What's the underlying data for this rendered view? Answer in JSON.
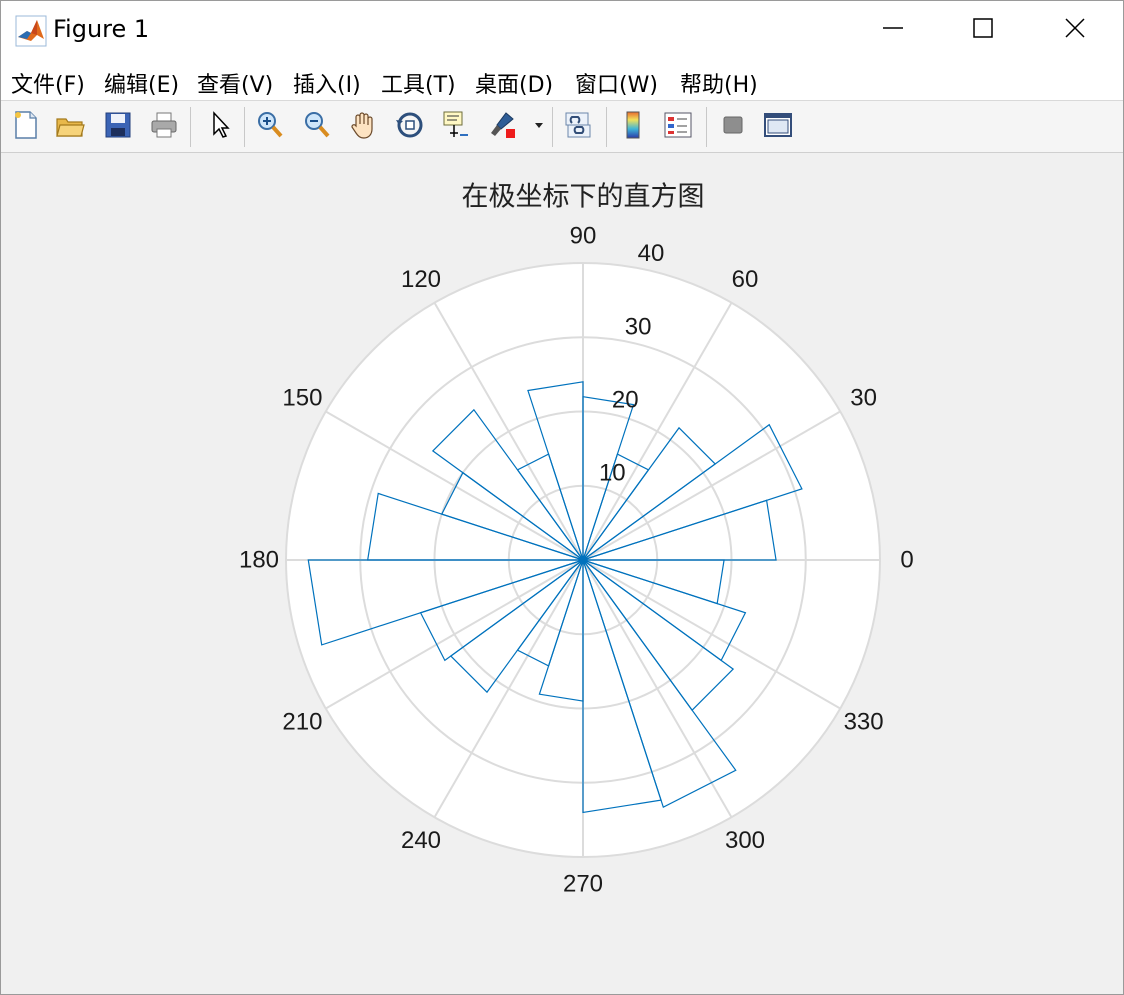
{
  "window": {
    "title": "Figure 1",
    "app_icon": "matlab-icon",
    "controls": [
      "minimize-icon",
      "maximize-icon",
      "close-icon"
    ]
  },
  "menubar": {
    "items": [
      {
        "label": "文件(F)",
        "name": "menu-file"
      },
      {
        "label": "编辑(E)",
        "name": "menu-edit"
      },
      {
        "label": "查看(V)",
        "name": "menu-view"
      },
      {
        "label": "插入(I)",
        "name": "menu-insert"
      },
      {
        "label": "工具(T)",
        "name": "menu-tools"
      },
      {
        "label": "桌面(D)",
        "name": "menu-desktop"
      },
      {
        "label": "窗口(W)",
        "name": "menu-window"
      },
      {
        "label": "帮助(H)",
        "name": "menu-help"
      }
    ]
  },
  "toolbar": {
    "buttons": [
      "new-figure-icon",
      "open-file-icon",
      "save-icon",
      "print-icon",
      "select-arrow-icon",
      "zoom-in-icon",
      "zoom-out-icon",
      "pan-hand-icon",
      "rotate-3d-icon",
      "data-cursor-icon",
      "brush-icon",
      "brush-dropdown-icon",
      "link-plot-icon",
      "colorbar-icon",
      "legend-icon",
      "hide-plot-tools-icon",
      "show-plot-tools-icon"
    ]
  },
  "colors": {
    "series": "#0072bd",
    "grid": "#dcdcdc",
    "axes_bg": "#ffffff",
    "figure_bg": "#f0f0f0"
  },
  "chart_data": {
    "type": "polar-histogram",
    "title": "在极坐标下的直方图",
    "theta_unit": "degrees",
    "theta_ticks": [
      0,
      30,
      60,
      90,
      120,
      150,
      180,
      210,
      240,
      270,
      300,
      330
    ],
    "r_ticks": [
      10,
      20,
      30,
      40
    ],
    "r_lim": [
      0,
      40
    ],
    "bin_width_deg": 18,
    "bins": [
      {
        "start": 0,
        "end": 18,
        "value": 26
      },
      {
        "start": 18,
        "end": 36,
        "value": 31
      },
      {
        "start": 36,
        "end": 54,
        "value": 22
      },
      {
        "start": 54,
        "end": 72,
        "value": 15
      },
      {
        "start": 72,
        "end": 90,
        "value": 22
      },
      {
        "start": 90,
        "end": 108,
        "value": 24
      },
      {
        "start": 108,
        "end": 126,
        "value": 15
      },
      {
        "start": 126,
        "end": 144,
        "value": 25
      },
      {
        "start": 144,
        "end": 162,
        "value": 20
      },
      {
        "start": 162,
        "end": 180,
        "value": 29
      },
      {
        "start": 180,
        "end": 198,
        "value": 37
      },
      {
        "start": 198,
        "end": 216,
        "value": 23
      },
      {
        "start": 216,
        "end": 234,
        "value": 22
      },
      {
        "start": 234,
        "end": 252,
        "value": 15
      },
      {
        "start": 252,
        "end": 270,
        "value": 19
      },
      {
        "start": 270,
        "end": 288,
        "value": 34
      },
      {
        "start": 288,
        "end": 306,
        "value": 35
      },
      {
        "start": 306,
        "end": 324,
        "value": 25
      },
      {
        "start": 324,
        "end": 342,
        "value": 23
      },
      {
        "start": 342,
        "end": 360,
        "value": 19
      }
    ]
  }
}
